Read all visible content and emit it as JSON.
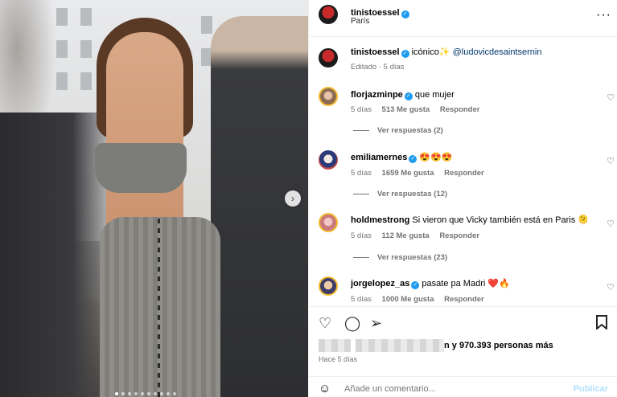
{
  "photo": {
    "dots": 10,
    "active_dot": 1,
    "next_icon": "chevron-right-icon",
    "next_glyph": "›"
  },
  "post": {
    "author": "tinistoessel",
    "location": "París",
    "caption_user": "tinistoessel",
    "caption_text": "icónico",
    "caption_emoji": "✨",
    "caption_mention": "@ludovicdesaintsernin",
    "caption_meta": "Editado · 5 días",
    "more_icon": "more-horizontal-icon",
    "more_glyph": "···"
  },
  "comments": [
    {
      "user": "florjazminpe",
      "text": "que mujer",
      "age": "5 días",
      "likes": "513 Me gusta",
      "reply": "Responder",
      "replies": "Ver respuestas (2)"
    },
    {
      "user": "emiliamernes",
      "text": "😍😍😍",
      "age": "5 días",
      "likes": "1659 Me gusta",
      "reply": "Responder",
      "replies": "Ver respuestas (12)"
    },
    {
      "user": "holdmestrong",
      "text": "Si vieron que Vicky también está en Paris 🫠",
      "age": "5 días",
      "likes": "112 Me gusta",
      "reply": "Responder",
      "replies": "Ver respuestas (23)"
    },
    {
      "user": "jorgelopez_as",
      "text": "pasate pa Madri ❤️🔥",
      "age": "5 días",
      "likes": "1000 Me gusta",
      "reply": "Responder"
    }
  ],
  "likes_text": "n y 970.393 personas más",
  "post_age": "Hace 5 días",
  "compose": {
    "emoji_icon": "smiley-icon",
    "placeholder": "Añade un comentario...",
    "publish": "Publicar"
  },
  "icons": {
    "like": "heart-icon",
    "comment": "comment-icon",
    "share": "send-icon",
    "save": "bookmark-icon"
  },
  "colors": {
    "link": "#00376b",
    "muted": "#737373",
    "verified": "#1d9bf0",
    "publish_disabled": "#b2dffc"
  }
}
